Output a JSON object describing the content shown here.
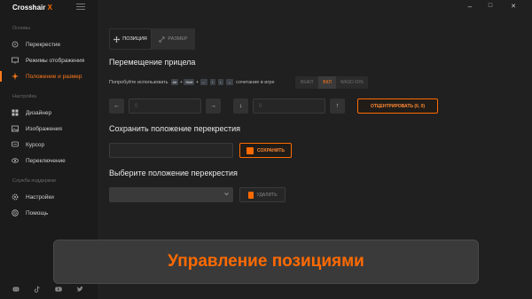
{
  "app": {
    "name": "Crosshair",
    "name_x": "X"
  },
  "window": {
    "minimize": "–",
    "maximize": "□",
    "close": "✕"
  },
  "sidebar": {
    "section_basics": "Основы",
    "section_settings": "Настройка",
    "section_support": "Служба поддержки",
    "items": [
      {
        "label": "Перекрестие",
        "icon": "crosshair-icon"
      },
      {
        "label": "Режимы отображения",
        "icon": "monitor-icon"
      },
      {
        "label": "Положение и размер",
        "icon": "move-icon",
        "active": true
      },
      {
        "label": "Дизайнер",
        "icon": "grid-icon"
      },
      {
        "label": "Изображения",
        "icon": "image-icon"
      },
      {
        "label": "Курсор",
        "icon": "cursor-icon"
      },
      {
        "label": "Переключение",
        "icon": "eye-icon"
      },
      {
        "label": "Настройки",
        "icon": "gear-icon"
      },
      {
        "label": "Помощь",
        "icon": "help-icon"
      }
    ],
    "social": [
      "discord-icon",
      "tiktok-icon",
      "youtube-icon",
      "twitter-icon"
    ]
  },
  "tabs": {
    "position": "ПОЗИЦИЯ",
    "size": "РАЗМЕР"
  },
  "move": {
    "title": "Перемещение прицела",
    "hint_prefix": "Попробуйте использовать",
    "hint_suffix": "сочетание в игре",
    "keys": [
      "Alt",
      "Shift",
      "←",
      "↑",
      "↓",
      "→"
    ],
    "plus": "+",
    "modes": [
      "ВЫКЛ",
      "ВКЛ",
      "WASD 60%"
    ],
    "active_mode": "ВКЛ",
    "x_value": "0",
    "y_value": "0",
    "center_button": "ОТЦЕНТРИРОВАТЬ (0, 0)"
  },
  "save": {
    "title": "Сохранить положение перекрестия",
    "input_value": "",
    "button": "СОХРАНИТЬ"
  },
  "choose": {
    "title": "Выберите положение перекрестия",
    "selected": "",
    "delete_button": "УДАЛИТЬ"
  },
  "banner": {
    "text": "Управление позициями"
  },
  "colors": {
    "accent": "#ff6a00",
    "background": "#202020",
    "sidebar": "#1b1b1b"
  }
}
